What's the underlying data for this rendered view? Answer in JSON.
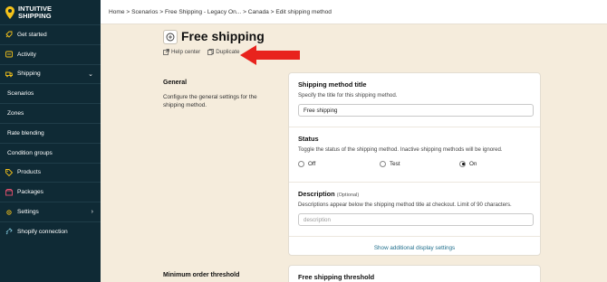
{
  "brand": {
    "line1": "INTUITIVE",
    "line2": "SHIPPING"
  },
  "sidebar": {
    "items": [
      {
        "label": "Get started",
        "icon": "rocket-icon"
      },
      {
        "label": "Activity",
        "icon": "activity-icon"
      },
      {
        "label": "Shipping",
        "icon": "truck-icon",
        "expanded": true
      },
      {
        "label": "Scenarios",
        "sub": true
      },
      {
        "label": "Zones",
        "sub": true
      },
      {
        "label": "Rate blending",
        "sub": true
      },
      {
        "label": "Condition groups",
        "sub": true
      },
      {
        "label": "Products",
        "icon": "tag-icon"
      },
      {
        "label": "Packages",
        "icon": "package-icon"
      },
      {
        "label": "Settings",
        "icon": "gear-icon"
      },
      {
        "label": "Shopify connection",
        "icon": "link-icon"
      }
    ]
  },
  "breadcrumb": {
    "text": "Home > Scenarios > Free Shipping - Legacy On... > Canada > Edit shipping method"
  },
  "page": {
    "title": "Free shipping",
    "help_label": "Help center",
    "duplicate_label": "Duplicate"
  },
  "general": {
    "label": "General",
    "description": "Configure the general settings for the shipping method."
  },
  "method_title": {
    "label": "Shipping method title",
    "help": "Specify the title for this shipping method.",
    "value": "Free shipping"
  },
  "status": {
    "label": "Status",
    "help": "Toggle the status of the shipping method. Inactive shipping methods will be ignored.",
    "options": [
      "Off",
      "Test",
      "On"
    ],
    "selected": "On"
  },
  "description": {
    "label": "Description",
    "optional": "(Optional)",
    "help": "Descriptions appear below the shipping method title at checkout. Limit of 90 characters.",
    "placeholder": "description"
  },
  "show_more": "Show additional display settings",
  "threshold": {
    "label": "Minimum order threshold",
    "card_title": "Free shipping threshold"
  },
  "colors": {
    "sidebar": "#0f2a35",
    "accent_yellow": "#f4c21a",
    "link": "#1f6e8c",
    "arrow": "#e8231d",
    "page_bg": "#f5ecdc"
  }
}
